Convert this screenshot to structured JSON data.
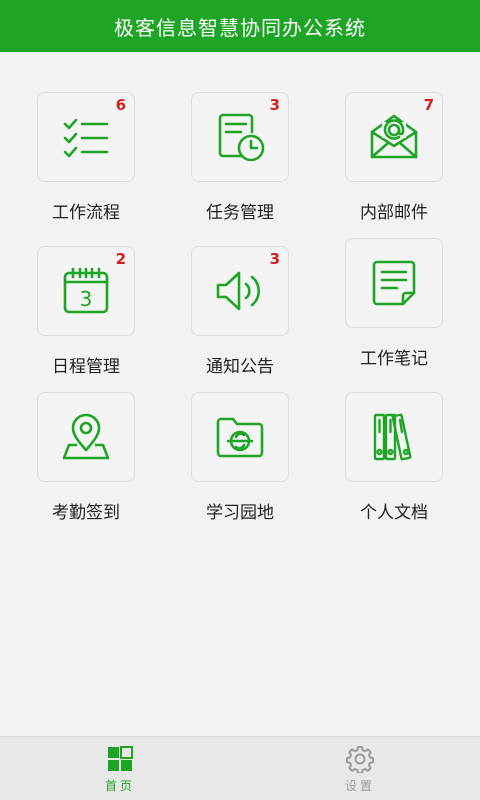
{
  "header": {
    "title": "极客信息智慧协同办公系统"
  },
  "colors": {
    "accent": "#1ea526",
    "badge": "#d42020",
    "tab_inactive": "#9a9a9a"
  },
  "tiles": [
    {
      "label": "工作流程",
      "badge": "6",
      "icon": "checklist-icon"
    },
    {
      "label": "任务管理",
      "badge": "3",
      "icon": "task-clock-icon"
    },
    {
      "label": "内部邮件",
      "badge": "7",
      "icon": "mail-icon"
    },
    {
      "label": "日程管理",
      "badge": "2",
      "icon": "calendar-icon"
    },
    {
      "label": "通知公告",
      "badge": "3",
      "icon": "speaker-icon"
    },
    {
      "label": "工作笔记",
      "badge": "",
      "icon": "note-icon"
    },
    {
      "label": "考勤签到",
      "badge": "",
      "icon": "location-icon"
    },
    {
      "label": "学习园地",
      "badge": "",
      "icon": "folder-icon"
    },
    {
      "label": "个人文档",
      "badge": "",
      "icon": "binders-icon"
    }
  ],
  "calendar_day": "3",
  "tabbar": {
    "home": {
      "label": "首页",
      "icon": "home-grid-icon",
      "active": true
    },
    "settings": {
      "label": "设置",
      "icon": "gear-icon",
      "active": false
    }
  }
}
